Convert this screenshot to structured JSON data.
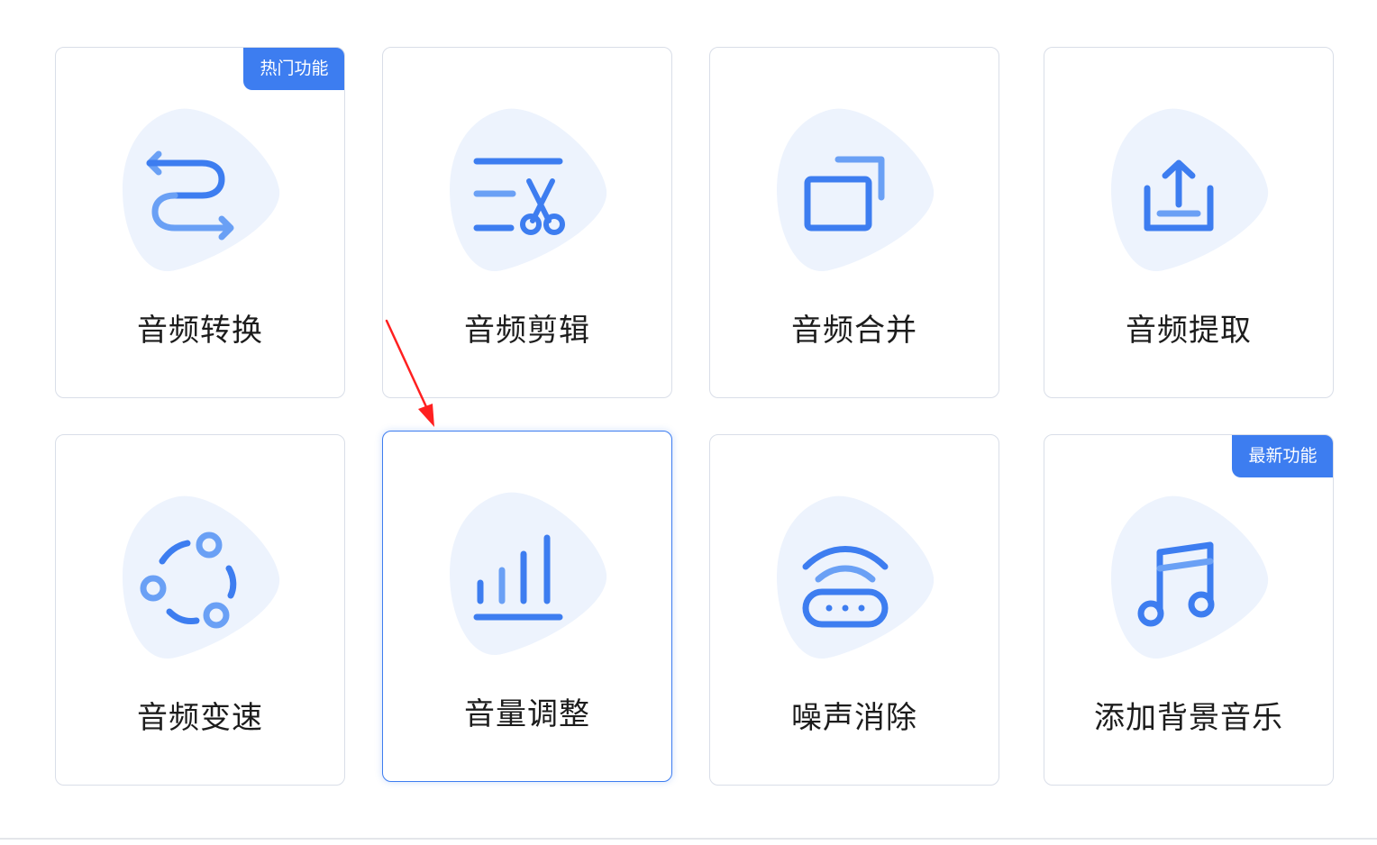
{
  "cards": [
    {
      "label": "音频转换",
      "badge": "热门功能",
      "icon": "convert-arrows-icon"
    },
    {
      "label": "音频剪辑",
      "icon": "scissors-cut-icon"
    },
    {
      "label": "音频合并",
      "icon": "merge-windows-icon"
    },
    {
      "label": "音频提取",
      "icon": "extract-upload-icon"
    },
    {
      "label": "音频变速",
      "icon": "speed-cycle-icon"
    },
    {
      "label": "音量调整",
      "icon": "volume-bars-icon",
      "selected": true
    },
    {
      "label": "噪声消除",
      "icon": "noise-router-icon"
    },
    {
      "label": "添加背景音乐",
      "badge": "最新功能",
      "icon": "music-note-icon"
    }
  ],
  "colors": {
    "accent": "#3d7df0",
    "accent_light": "#6aa0f5",
    "blob": "#edf3fd",
    "annotation": "#ff2020"
  }
}
